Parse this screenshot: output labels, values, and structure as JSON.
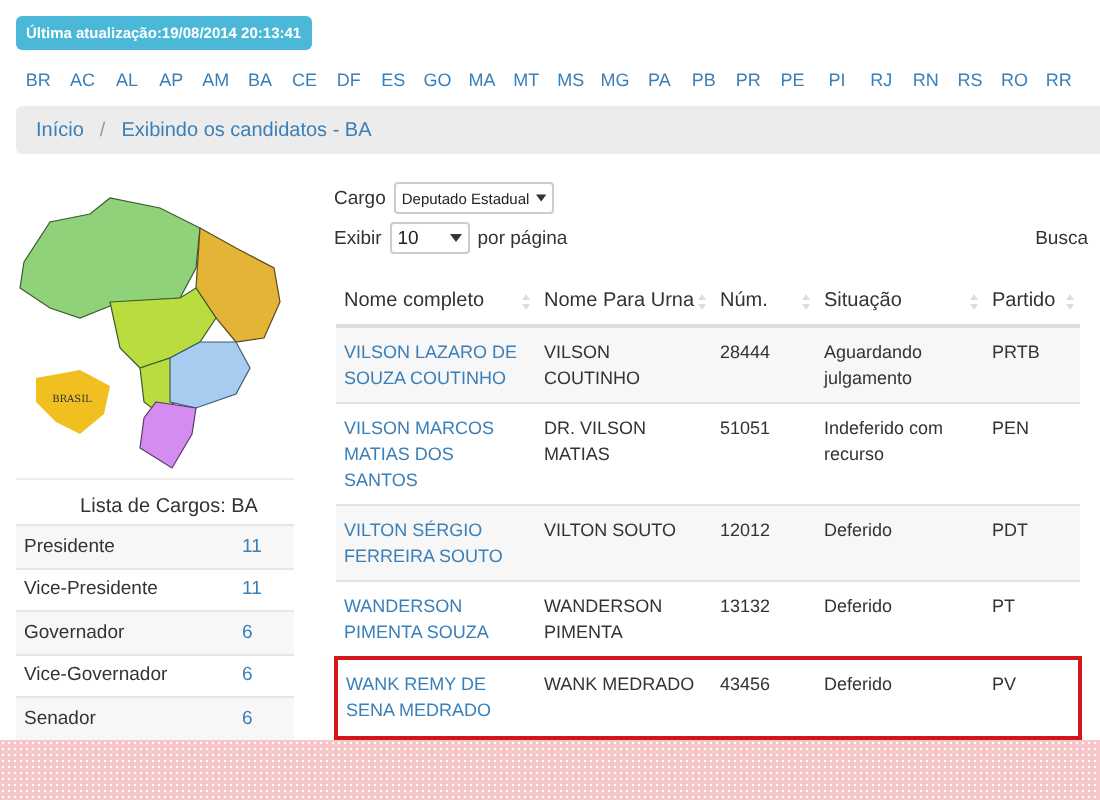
{
  "update_badge": "Última atualização:19/08/2014 20:13:41",
  "states": [
    "BR",
    "AC",
    "AL",
    "AP",
    "AM",
    "BA",
    "CE",
    "DF",
    "ES",
    "GO",
    "MA",
    "MT",
    "MS",
    "MG",
    "PA",
    "PB",
    "PR",
    "PE",
    "PI",
    "RJ",
    "RN",
    "RS",
    "RO",
    "RR"
  ],
  "breadcrumb": {
    "items": [
      "Início",
      "Exibindo os candidatos - BA"
    ],
    "separator": "/"
  },
  "map": {
    "inset_label": "BRASIL"
  },
  "cargos": {
    "title": "Lista de Cargos: BA",
    "items": [
      {
        "name": "Presidente",
        "count": "11"
      },
      {
        "name": "Vice-Presidente",
        "count": "11"
      },
      {
        "name": "Governador",
        "count": "6"
      },
      {
        "name": "Vice-Governador",
        "count": "6"
      },
      {
        "name": "Senador",
        "count": "6"
      }
    ]
  },
  "filters": {
    "cargo_label": "Cargo",
    "cargo_value": "Deputado Estadual",
    "show_label": "Exibir",
    "show_value": "10",
    "per_page_label": "por página",
    "search_label": "Busca"
  },
  "table": {
    "columns": [
      "Nome completo",
      "Nome Para Urna",
      "Núm.",
      "Situação",
      "Partido"
    ],
    "rows": [
      {
        "cells": [
          "VILSON LAZARO DE SOUZA COUTINHO",
          "VILSON COUTINHO",
          "28444",
          "Aguardando julgamento",
          "PRTB"
        ],
        "highlighted": false
      },
      {
        "cells": [
          "VILSON MARCOS MATIAS DOS SANTOS",
          "DR. VILSON MATIAS",
          "51051",
          "Indeferido com recurso",
          "PEN"
        ],
        "highlighted": false
      },
      {
        "cells": [
          "VILTON SÉRGIO FERREIRA SOUTO",
          "VILTON SOUTO",
          "12012",
          "Deferido",
          "PDT"
        ],
        "highlighted": false
      },
      {
        "cells": [
          "WANDERSON PIMENTA SOUZA",
          "WANDERSON PIMENTA",
          "13132",
          "Deferido",
          "PT"
        ],
        "highlighted": false
      },
      {
        "cells": [
          "WANK REMY DE SENA MEDRADO",
          "WANK MEDRADO",
          "43456",
          "Deferido",
          "PV"
        ],
        "highlighted": true
      }
    ]
  }
}
